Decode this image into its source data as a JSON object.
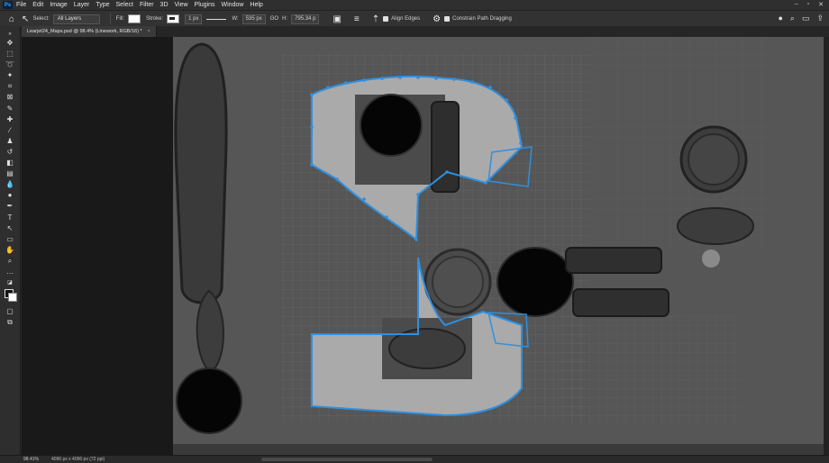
{
  "menubar": {
    "app_badge": "Ps",
    "items": [
      "File",
      "Edit",
      "Image",
      "Layer",
      "Type",
      "Select",
      "Filter",
      "3D",
      "View",
      "Plugins",
      "Window",
      "Help"
    ],
    "window_controls": [
      "–",
      "▫",
      "✕"
    ]
  },
  "options": {
    "select_label": "Select:",
    "select_value": "All Layers",
    "fill_label": "Fill:",
    "stroke_label": "Stroke:",
    "stroke_width": "1 px",
    "w_label": "W:",
    "w_value": "535 px",
    "link_icon": "GO",
    "h_label": "H:",
    "h_value": "795.34 p",
    "align_edges_label": "Align Edges",
    "constrain_label": "Constrain Path Dragging"
  },
  "document": {
    "tab_title": "Learjet24_Maps.psd @ 98.4% (Linework, RGB/16) *",
    "tab_close": "×"
  },
  "status": {
    "zoom": "98.41%",
    "doc_size": "4096 px x 4096 px (72 ppi)"
  },
  "colors": {
    "path_blue": "#2f8fe0",
    "canvas_gray": "#5b5b5b",
    "selection_fill": "#a9a9a9",
    "wire": "#8a8a8a"
  }
}
